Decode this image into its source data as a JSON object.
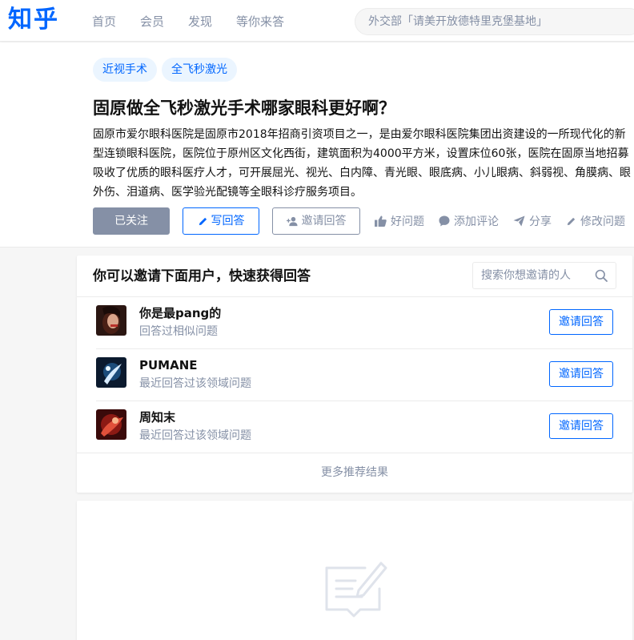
{
  "header": {
    "logo": "知乎",
    "nav": [
      "首页",
      "会员",
      "发现",
      "等你来答"
    ],
    "search_placeholder": "外交部「请美开放德特里克堡基地」"
  },
  "question": {
    "tags": [
      "近视手术",
      "全飞秒激光"
    ],
    "title": "固原做全飞秒激光手术哪家眼科更好啊？",
    "description": "固原市爱尔眼科医院是固原市2018年招商引资项目之一，是由爱尔眼科医院集团出资建设的一所现代化的新型连锁眼科医院，医院位于原州区文化西街，建筑面积为4000平方米，设置床位60张，医院在固原当地招募吸收了优质的眼科医疗人才，可开展屈光、视光、白内障、青光眼、眼底病、小儿眼病、斜弱视、角膜病、眼外伤、泪道病、医学验光配镜等全眼科诊疗服务项目。",
    "actions": {
      "followed": "已关注",
      "write": "写回答",
      "invite": "邀请回答",
      "good": "好问题",
      "comment": "添加评论",
      "share": "分享",
      "edit": "修改问题"
    }
  },
  "invite": {
    "heading": "你可以邀请下面用户，快速获得回答",
    "search_placeholder": "搜索你想邀请的人",
    "users": [
      {
        "name": "你是最pang的",
        "reason": "回答过相似问题",
        "button": "邀请回答"
      },
      {
        "name": "PUMANE",
        "reason": "最近回答过该领域问题",
        "button": "邀请回答"
      },
      {
        "name": "周知末",
        "reason": "最近回答过该领域问题",
        "button": "邀请回答"
      }
    ],
    "more": "更多推荐结果"
  },
  "colors": {
    "brand": "#0066ff",
    "muted": "#8590a6",
    "tag_bg": "#ebf5ff"
  }
}
